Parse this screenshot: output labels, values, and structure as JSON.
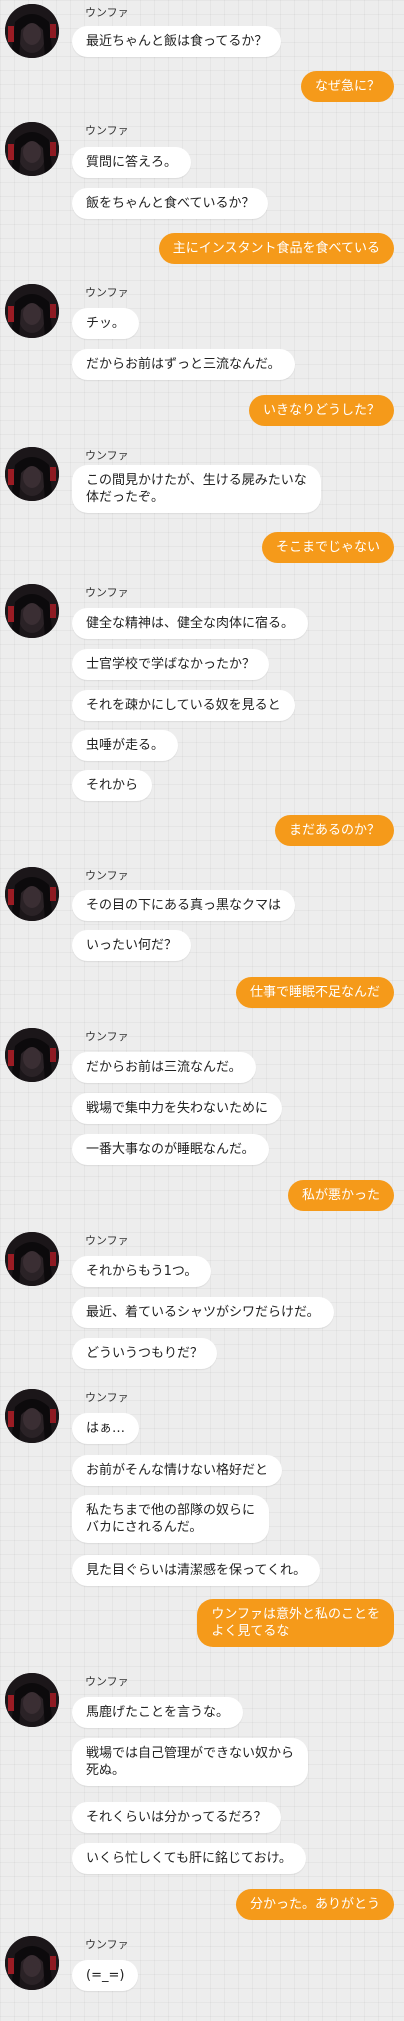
{
  "colors": {
    "incoming_bubble": "#ffffff",
    "outgoing_bubble": "#f59a1a",
    "background": "#ededed"
  },
  "messages": [
    {
      "type": "avatar",
      "sender": "ウンファ"
    },
    {
      "type": "in",
      "text": "最近ちゃんと飯は食ってるか？"
    },
    {
      "type": "out",
      "text": "なぜ急に？"
    },
    {
      "type": "avatar",
      "sender": "ウンファ"
    },
    {
      "type": "in",
      "text": "質問に答えろ。"
    },
    {
      "type": "in",
      "text": "飯をちゃんと食べているか？"
    },
    {
      "type": "out",
      "text": "主にインスタント食品を食べている"
    },
    {
      "type": "avatar",
      "sender": "ウンファ"
    },
    {
      "type": "in",
      "text": "チッ。"
    },
    {
      "type": "in",
      "text": "だからお前はずっと三流なんだ。"
    },
    {
      "type": "out",
      "text": "いきなりどうした？"
    },
    {
      "type": "avatar",
      "sender": "ウンファ"
    },
    {
      "type": "in",
      "text": "この間見かけたが、生ける屍みたいな\n体だったぞ。"
    },
    {
      "type": "out",
      "text": "そこまでじゃない"
    },
    {
      "type": "avatar",
      "sender": "ウンファ"
    },
    {
      "type": "in",
      "text": "健全な精神は、健全な肉体に宿る。"
    },
    {
      "type": "in",
      "text": "士官学校で学ばなかったか？"
    },
    {
      "type": "in",
      "text": "それを疎かにしている奴を見ると"
    },
    {
      "type": "in",
      "text": "虫唾が走る。"
    },
    {
      "type": "in",
      "text": "それから"
    },
    {
      "type": "out",
      "text": "まだあるのか？"
    },
    {
      "type": "avatar",
      "sender": "ウンファ"
    },
    {
      "type": "in",
      "text": "その目の下にある真っ黒なクマは"
    },
    {
      "type": "in",
      "text": "いったい何だ？"
    },
    {
      "type": "out",
      "text": "仕事で睡眠不足なんだ"
    },
    {
      "type": "avatar",
      "sender": "ウンファ"
    },
    {
      "type": "in",
      "text": "だからお前は三流なんだ。"
    },
    {
      "type": "in",
      "text": "戦場で集中力を失わないために"
    },
    {
      "type": "in",
      "text": "一番大事なのが睡眠なんだ。"
    },
    {
      "type": "out",
      "text": "私が悪かった"
    },
    {
      "type": "avatar",
      "sender": "ウンファ"
    },
    {
      "type": "in",
      "text": "それからもう1つ。"
    },
    {
      "type": "in",
      "text": "最近、着ているシャツがシワだらけだ。"
    },
    {
      "type": "in",
      "text": "どういうつもりだ？"
    },
    {
      "type": "avatar",
      "sender": "ウンファ"
    },
    {
      "type": "in",
      "text": "はぁ…"
    },
    {
      "type": "in",
      "text": "お前がそんな情けない格好だと"
    },
    {
      "type": "in",
      "text": "私たちまで他の部隊の奴らに\nバカにされるんだ。"
    },
    {
      "type": "in",
      "text": "見た目ぐらいは清潔感を保ってくれ。"
    },
    {
      "type": "out",
      "text": "ウンファは意外と私のことを\nよく見てるな"
    },
    {
      "type": "avatar",
      "sender": "ウンファ"
    },
    {
      "type": "in",
      "text": "馬鹿げたことを言うな。"
    },
    {
      "type": "in",
      "text": "戦場では自己管理ができない奴から\n死ぬ。"
    },
    {
      "type": "in",
      "text": "それくらいは分かってるだろ？"
    },
    {
      "type": "in",
      "text": "いくら忙しくても肝に銘じておけ。"
    },
    {
      "type": "out",
      "text": "分かった。ありがとう"
    },
    {
      "type": "avatar",
      "sender": "ウンファ"
    },
    {
      "type": "in",
      "text": "(=_=)"
    }
  ]
}
